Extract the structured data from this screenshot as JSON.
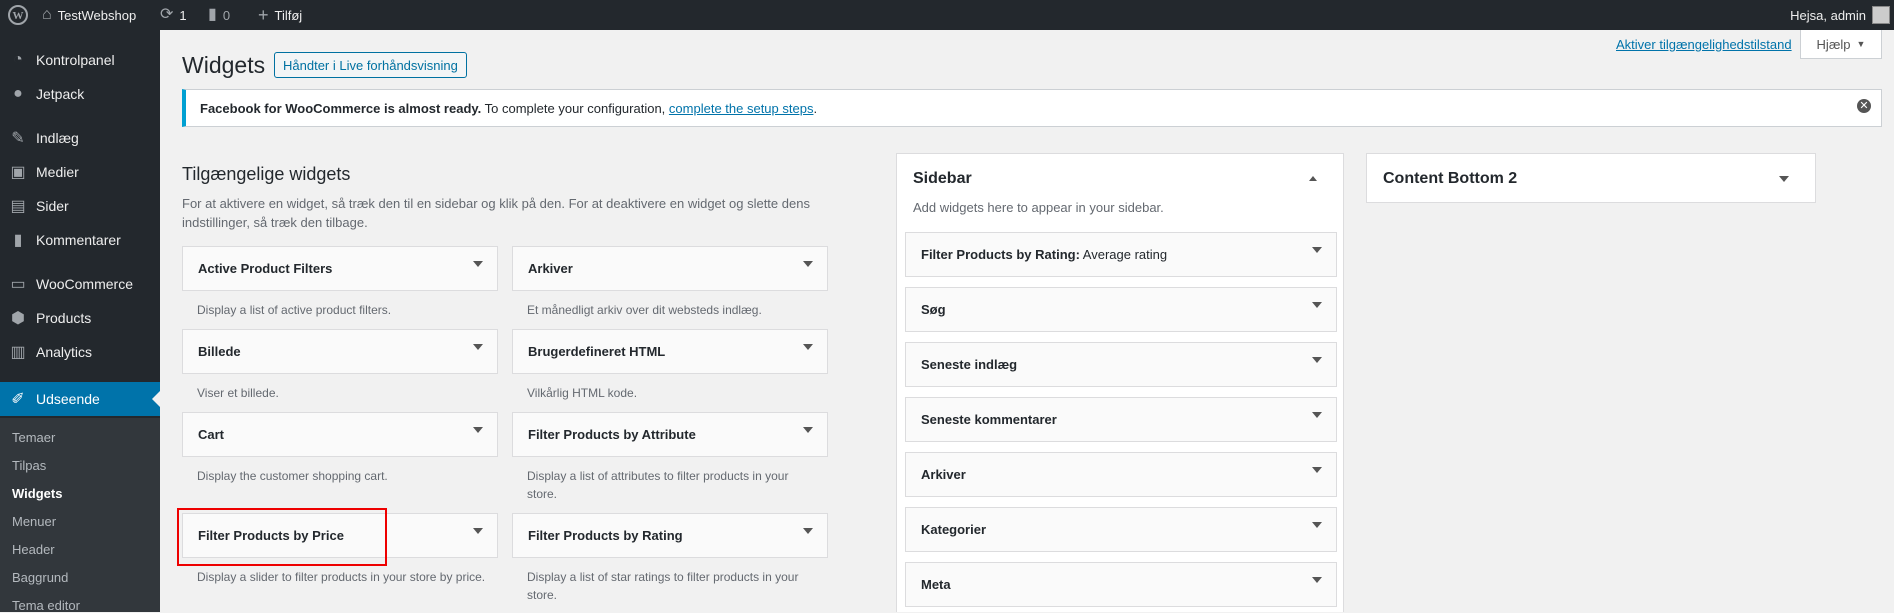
{
  "adminbar": {
    "site_name": "TestWebshop",
    "updates_count": "1",
    "comments_count": "0",
    "new_label": "Tilføj",
    "greeting": "Hejsa, admin"
  },
  "menu": {
    "items": [
      {
        "label": "Kontrolpanel",
        "icon": "dashboard-icon"
      },
      {
        "label": "Jetpack",
        "icon": "jetpack-icon"
      },
      {
        "label": "Indlæg",
        "icon": "pin-icon"
      },
      {
        "label": "Medier",
        "icon": "media-icon"
      },
      {
        "label": "Sider",
        "icon": "pages-icon"
      },
      {
        "label": "Kommentarer",
        "icon": "comments-icon"
      },
      {
        "label": "WooCommerce",
        "icon": "woocommerce-icon"
      },
      {
        "label": "Products",
        "icon": "products-icon"
      },
      {
        "label": "Analytics",
        "icon": "analytics-icon"
      },
      {
        "label": "Udseende",
        "icon": "appearance-icon"
      }
    ],
    "submenu": [
      "Temaer",
      "Tilpas",
      "Widgets",
      "Menuer",
      "Header",
      "Baggrund",
      "Tema editor"
    ]
  },
  "header": {
    "title": "Widgets",
    "live_button": "Håndter i Live forhåndsvisning",
    "a11y_link": "Aktiver tilgængelighedstilstand",
    "help_button": "Hjælp"
  },
  "notice": {
    "bold": "Facebook for WooCommerce is almost ready.",
    "text": " To complete your configuration, ",
    "link": "complete the setup steps",
    "end": "."
  },
  "available": {
    "title": "Tilgængelige widgets",
    "description": "For at aktivere en widget, så træk den til en sidebar og klik på den. For at deaktivere en widget og slette dens indstillinger, så træk den tilbage.",
    "widgets": [
      {
        "title": "Active Product Filters",
        "desc": "Display a list of active product filters."
      },
      {
        "title": "Arkiver",
        "desc": "Et månedligt arkiv over dit websteds indlæg."
      },
      {
        "title": "Billede",
        "desc": "Viser et billede."
      },
      {
        "title": "Brugerdefineret HTML",
        "desc": "Vilkårlig HTML kode."
      },
      {
        "title": "Cart",
        "desc": "Display the customer shopping cart."
      },
      {
        "title": "Filter Products by Attribute",
        "desc": "Display a list of attributes to filter products in your store."
      },
      {
        "title": "Filter Products by Price",
        "desc": "Display a slider to filter products in your store by price."
      },
      {
        "title": "Filter Products by Rating",
        "desc": "Display a list of star ratings to filter products in your store."
      }
    ]
  },
  "sidebar": {
    "title": "Sidebar",
    "description": "Add widgets here to appear in your sidebar.",
    "widgets": [
      {
        "title": "Filter Products by Rating:",
        "subtitle": " Average rating"
      },
      {
        "title": "Søg",
        "subtitle": ""
      },
      {
        "title": "Seneste indlæg",
        "subtitle": ""
      },
      {
        "title": "Seneste kommentarer",
        "subtitle": ""
      },
      {
        "title": "Arkiver",
        "subtitle": ""
      },
      {
        "title": "Kategorier",
        "subtitle": ""
      },
      {
        "title": "Meta",
        "subtitle": ""
      }
    ]
  },
  "content_bottom": {
    "title": "Content Bottom 2"
  },
  "colors": {
    "adminbar_bg": "#23282d",
    "accent": "#0073aa",
    "notice_border": "#00a0d2",
    "highlight": "#ee0000"
  }
}
